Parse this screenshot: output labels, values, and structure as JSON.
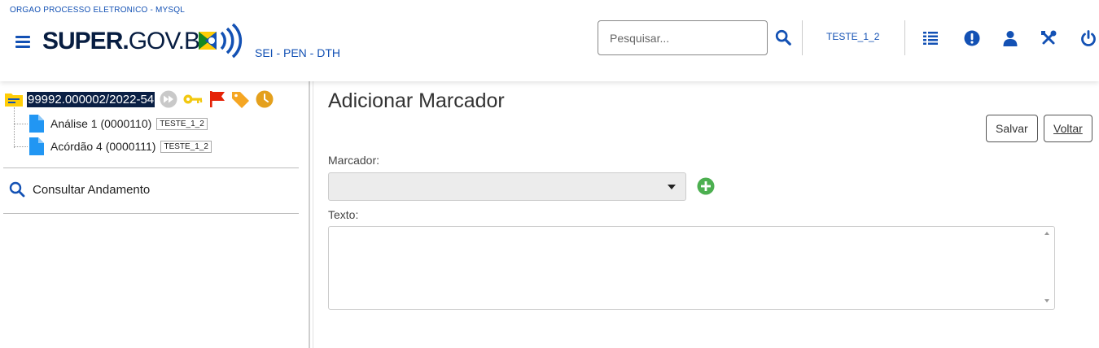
{
  "header": {
    "org_title": "ORGAO PROCESSO ELETRONICO - MYSQL",
    "logo_bold": "SUPER.",
    "logo_normal": "GOV.BR",
    "system_name": "SEI - PEN - DTH",
    "search_placeholder": "Pesquisar...",
    "user_unit": "TESTE_1_2",
    "icons": [
      "menu-icon",
      "search-icon",
      "list-icon",
      "alert-icon",
      "user-icon",
      "tools-icon",
      "power-icon"
    ]
  },
  "tree": {
    "process_number": "99992.000002/2022-54",
    "documents": [
      {
        "label": "Análise 1 (0000110)",
        "unit": "TESTE_1_2"
      },
      {
        "label": "Acórdão 4 (0000111)",
        "unit": "TESTE_1_2"
      }
    ],
    "consult_label": "Consultar Andamento"
  },
  "main": {
    "title": "Adicionar Marcador",
    "save_label": "Salvar",
    "back_label": "Voltar",
    "marker_label": "Marcador:",
    "marker_value": "",
    "text_label": "Texto:",
    "text_value": ""
  },
  "colors": {
    "brand_blue": "#1351b4",
    "dark_navy": "#071d41",
    "folder_yellow": "#ffcd07",
    "doc_blue": "#2196f3",
    "key_yellow": "#f2c811",
    "flag_red": "#e52207",
    "tag_orange": "#f5a623",
    "clock_orange": "#e4a01d",
    "add_green": "#4caf50"
  }
}
